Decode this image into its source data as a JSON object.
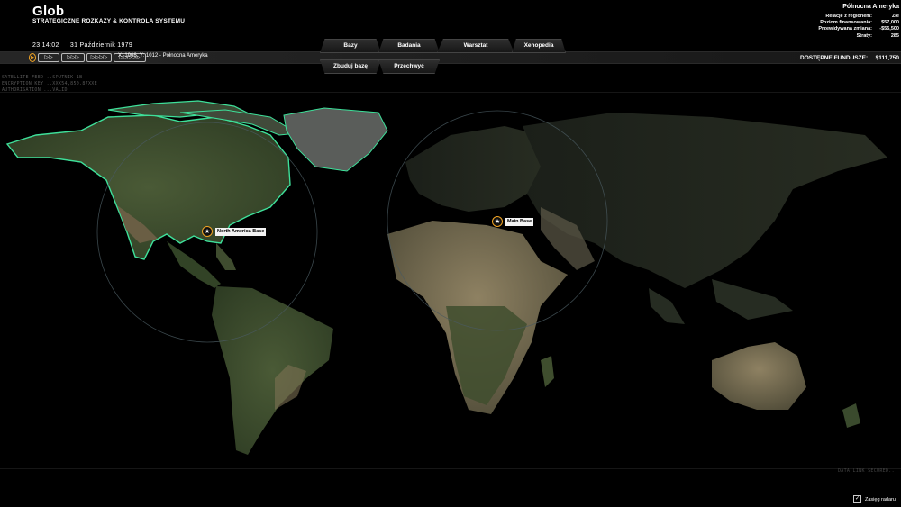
{
  "header": {
    "title": "Glob",
    "subtitle": "STRATEGICZNE ROZKAZY & KONTROLA SYSTEMU",
    "time": "23:14:02",
    "date": "31 Październik 1979"
  },
  "speed_controls": {
    "pause": "▶",
    "s1": "▷▷",
    "s2": "▷▷▷",
    "s3": "▷▷▷▷",
    "s4": "▷▷▷▷▷"
  },
  "coords": "X: 1966, Y: 1012 - Północna Ameryka",
  "nav": {
    "bases": "Bazy",
    "research": "Badania",
    "workshop": "Warsztat",
    "xenopedia": "Xenopedia",
    "build_base": "Zbuduj bazę",
    "intercept": "Przechwyć"
  },
  "funds": {
    "label": "DOSTĘPNE FUNDUSZE:",
    "value": "$111,750"
  },
  "region": {
    "name": "Północna Ameryka",
    "stats": [
      {
        "label": "Relacje z regionem:",
        "value": "Złe"
      },
      {
        "label": "Poziom finansowania:",
        "value": "$57,000"
      },
      {
        "label": "Przewidywana zmiana:",
        "value": "-$55,500"
      },
      {
        "label": "Straty:",
        "value": "285"
      }
    ]
  },
  "satellite": {
    "line1": "SATELLITE FEED ..SPUTNIK 1B",
    "line2": "ENCRYPTION KEY ..XXX54,850.87XXE",
    "line3": "AUTHORISATION ...VALID"
  },
  "data_link": "DATA LINK SECURED...",
  "radar_label": "Zasięg radaru",
  "bases": [
    {
      "name": "North America Base"
    },
    {
      "name": "Main Base"
    }
  ],
  "colors": {
    "selected_region": "#3ee09a",
    "land": "#3b4a2c",
    "desert": "#8a7c5c",
    "accent": "#f5a623"
  }
}
